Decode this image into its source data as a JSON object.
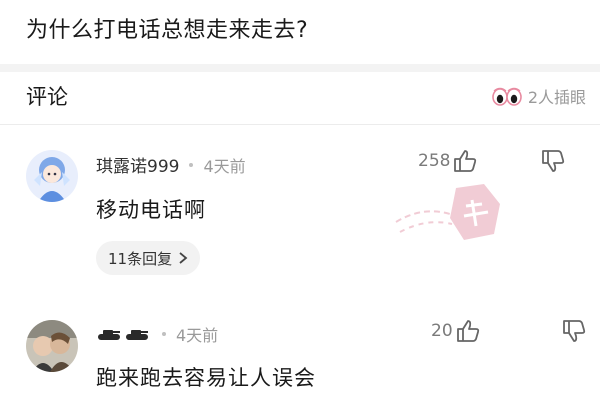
{
  "question": {
    "title": "为什么打电话总想走来走去?"
  },
  "comments_header": {
    "title": "评论",
    "watchers_label": "2人插眼"
  },
  "comments": [
    {
      "username": "琪露诺999",
      "time": "4天前",
      "likes": "258",
      "text": "移动电话啊",
      "replies_label": "11条回复"
    },
    {
      "username": "",
      "time": "4天前",
      "likes": "20",
      "text": "跑来跑去容易让人误会"
    }
  ],
  "colors": {
    "stamp": "#e7a4b4",
    "divider": "#f3f3f3",
    "muted_text": "#9a9a9a"
  },
  "icons": {
    "watchers": "eyes-icon",
    "like": "thumbs-up-icon",
    "dislike": "thumbs-down-icon",
    "chevron": "chevron-right-icon",
    "second_user_badge": "tank-icon"
  }
}
